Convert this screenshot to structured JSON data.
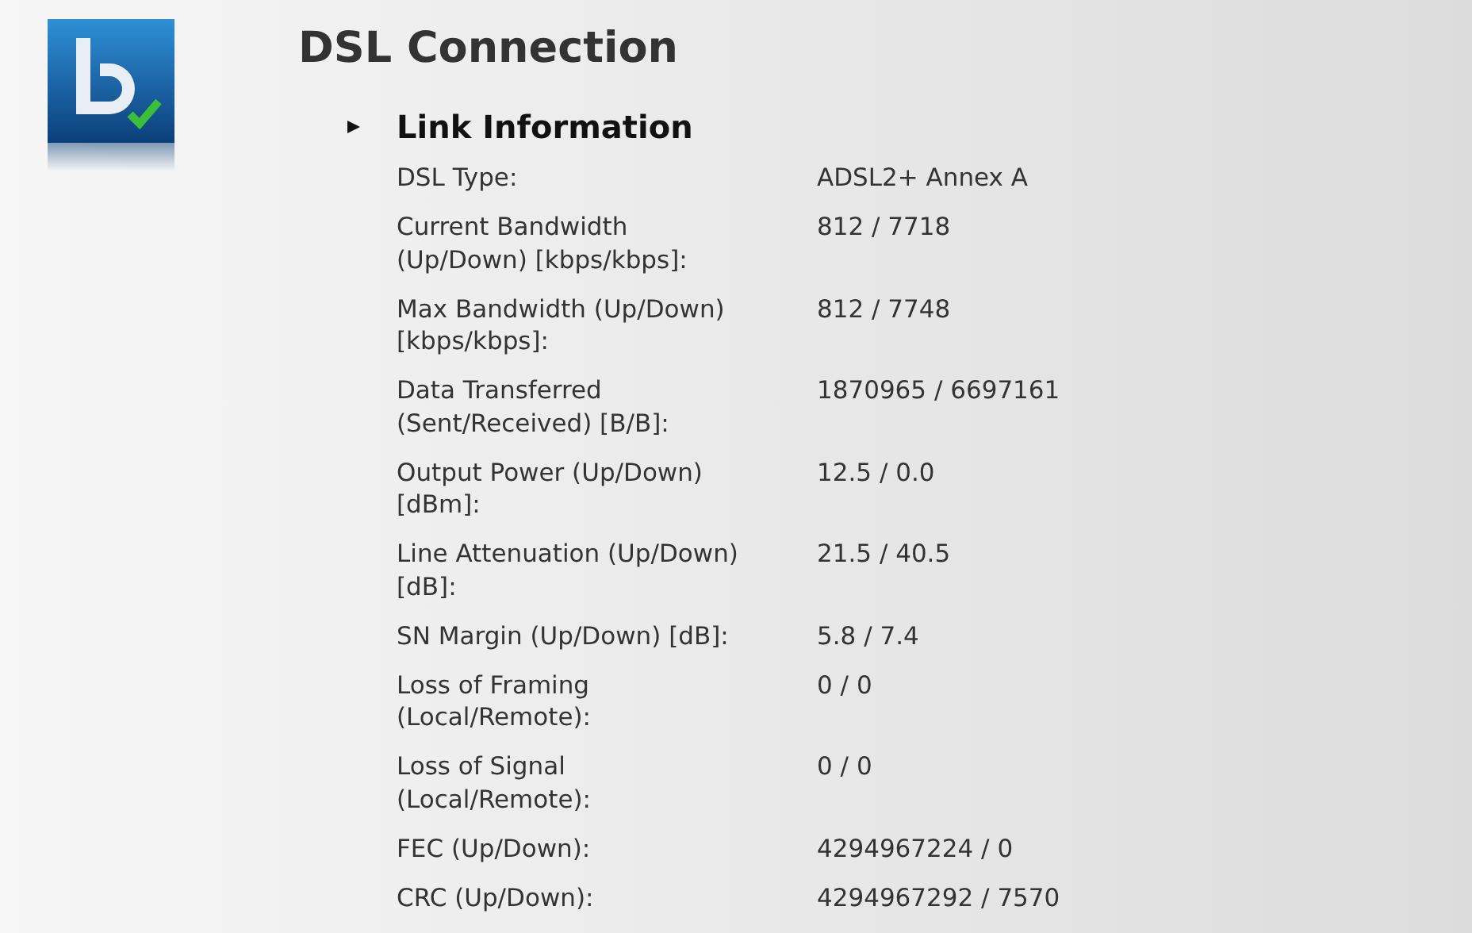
{
  "title": "DSL Connection",
  "section": {
    "title": "Link Information",
    "expanded": true,
    "rows": [
      {
        "label": "DSL Type:",
        "value": "ADSL2+ Annex A"
      },
      {
        "label": "Current Bandwidth\n(Up/Down) [kbps/kbps]:",
        "value": "812 / 7718"
      },
      {
        "label": "Max Bandwidth (Up/Down)\n[kbps/kbps]:",
        "value": "812 / 7748"
      },
      {
        "label": "Data Transferred\n(Sent/Received) [B/B]:",
        "value": "1870965 / 6697161"
      },
      {
        "label": "Output Power (Up/Down)\n[dBm]:",
        "value": "12.5 / 0.0"
      },
      {
        "label": "Line Attenuation (Up/Down)\n[dB]:",
        "value": "21.5 / 40.5"
      },
      {
        "label": "SN Margin (Up/Down) [dB]:",
        "value": "5.8 / 7.4"
      },
      {
        "label": "Loss of Framing\n(Local/Remote):",
        "value": "0 / 0"
      },
      {
        "label": "Loss of Signal\n(Local/Remote):",
        "value": "0 / 0"
      },
      {
        "label": "FEC (Up/Down):",
        "value": "4294967224 / 0"
      },
      {
        "label": "CRC (Up/Down):",
        "value": "4294967292 / 7570"
      }
    ]
  }
}
